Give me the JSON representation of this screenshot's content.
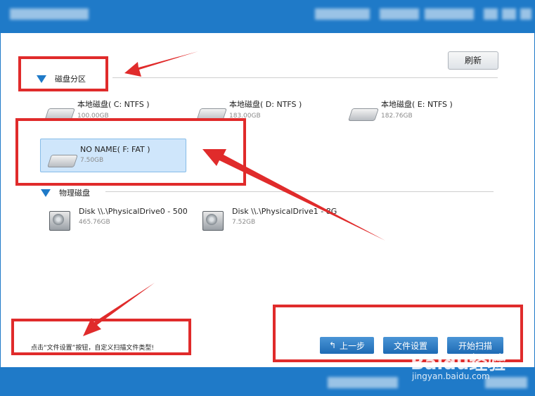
{
  "toolbar": {
    "refresh_label": "刷新"
  },
  "partitions": {
    "title": "磁盘分区",
    "items": [
      {
        "name": "本地磁盘( C: NTFS )",
        "size": "100.00GB"
      },
      {
        "name": "本地磁盘( D: NTFS )",
        "size": "183.00GB"
      },
      {
        "name": "本地磁盘( E: NTFS )",
        "size": "182.76GB"
      },
      {
        "name": "NO NAME( F: FAT )",
        "size": "7.50GB"
      }
    ]
  },
  "physical": {
    "title": "物理磁盘",
    "items": [
      {
        "name": "Disk \\\\.\\PhysicalDrive0 - 500",
        "size": "465.76GB"
      },
      {
        "name": "Disk \\\\.\\PhysicalDrive1 - 8G",
        "size": "7.52GB"
      }
    ]
  },
  "footer_actions": {
    "back_label": "上一步",
    "file_settings_label": "文件设置",
    "start_scan_label": "开始扫描"
  },
  "hint": "点击“文件设置”按钮，自定义扫描文件类型!",
  "watermark": {
    "brand": "Baidu经验",
    "url": "jingyan.baidu.com"
  },
  "colors": {
    "accent": "#1f7ac8",
    "annotation": "#e02b2b",
    "selected": "#cfe6fb"
  }
}
